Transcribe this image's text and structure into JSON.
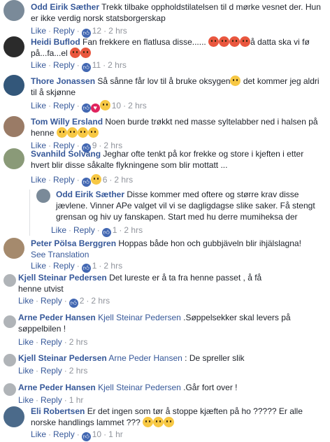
{
  "comments": [
    {
      "name": "Odd Eirik Sæther",
      "text": "Trekk tilbake oppholdstilatelsen til d mørke vesnet der. Hun er ikke verdig norsk statsborgerskap",
      "like": "Like",
      "reply": "Reply",
      "count": "12",
      "time": "2 hrs",
      "avatar_color": "#6b7b8a"
    },
    {
      "name": "Heidi Buflod",
      "text": "Fan frekkere en flatlusa disse......",
      "text_after": "å datta ska vi fø på...fa...el",
      "like": "Like",
      "reply": "Reply",
      "count": "11",
      "time": "2 hrs",
      "avatar_color": "#2b2b2b"
    },
    {
      "name": "Thore Jonassen",
      "text": "Så sånne får lov til å bruke oksygen",
      "text_after": "det kommer jeg aldri til å skjønne",
      "like": "Like",
      "reply": "Reply",
      "count": "10",
      "time": "2 hrs",
      "avatar_color": "#33577a"
    },
    {
      "name": "Tom Willy Ersland",
      "text": "Noen burde trøkkt ned masse syltelabber ned i halsen på henne",
      "like": "Like",
      "reply": "Reply",
      "count": "9",
      "time": "2 hrs",
      "avatar_color": "#9a7b66"
    },
    {
      "name": "Svanhild Solvang",
      "text": "Jeghar ofte tenkt på kor frekke og store i kjeften i etter hvert blir disse såkalte flykningene som blir mottatt ...",
      "like": "Like",
      "reply": "Reply",
      "count": "6",
      "time": "2 hrs",
      "avatar_color": "#8a9a78"
    },
    {
      "name": "Odd Eirik Sæther",
      "text": "Disse kommer med oftere og større krav disse jævlene. Vinner APe valget vil vi se dagligdagse slike saker. Få stengt grensan og hiv uy fanskapen. Start med hu derre mumiheksa der",
      "like": "Like",
      "reply": "Reply",
      "count": "1",
      "time": "2 hrs",
      "avatar_color": "#6b7b8a"
    },
    {
      "name": "Peter Pölsa Berggren",
      "text": "Hoppas både hon och gubbjäveln blir ihjälslagna!",
      "see_translation": "See Translation",
      "like": "Like",
      "reply": "Reply",
      "count": "1",
      "time": "2 hrs",
      "avatar_color": "#a58a6d"
    },
    {
      "name": "Kjell Steinar Pedersen",
      "text": "Det lureste er å ta fra henne passet , å få henne utvist",
      "like": "Like",
      "reply": "Reply",
      "count": "2",
      "time": "2 hrs",
      "avatar_color": "#b0b4b8"
    },
    {
      "name": "Arne Peder Hansen",
      "mention": "Kjell Steinar Pedersen",
      "text": ".Søppelsekker skal levers på søppelbilen !",
      "like": "Like",
      "reply": "Reply",
      "time": "2 hrs",
      "avatar_color": "#b0b4b8"
    },
    {
      "name": "Kjell Steinar Pedersen",
      "mention": "Arne Peder Hansen",
      "text": ": De spreller slik",
      "like": "Like",
      "reply": "Reply",
      "time": "2 hrs",
      "avatar_color": "#b0b4b8"
    },
    {
      "name": "Arne Peder Hansen",
      "mention": "Kjell Steinar Pedersen",
      "text": ".Går fort over !",
      "like": "Like",
      "reply": "Reply",
      "time": "1 hr",
      "avatar_color": "#b0b4b8"
    },
    {
      "name": "Eli Robertsen",
      "text": "Er det ingen som tør å stoppe kjæften på ho ????? Er alle norske handlings lammet ???",
      "like": "Like",
      "reply": "Reply",
      "count": "10",
      "time": "1 hr",
      "avatar_color": "#4b6a8a"
    }
  ],
  "colors": {
    "link": "#365899",
    "meta": "#90949c",
    "like_blue": "#4267b2"
  }
}
